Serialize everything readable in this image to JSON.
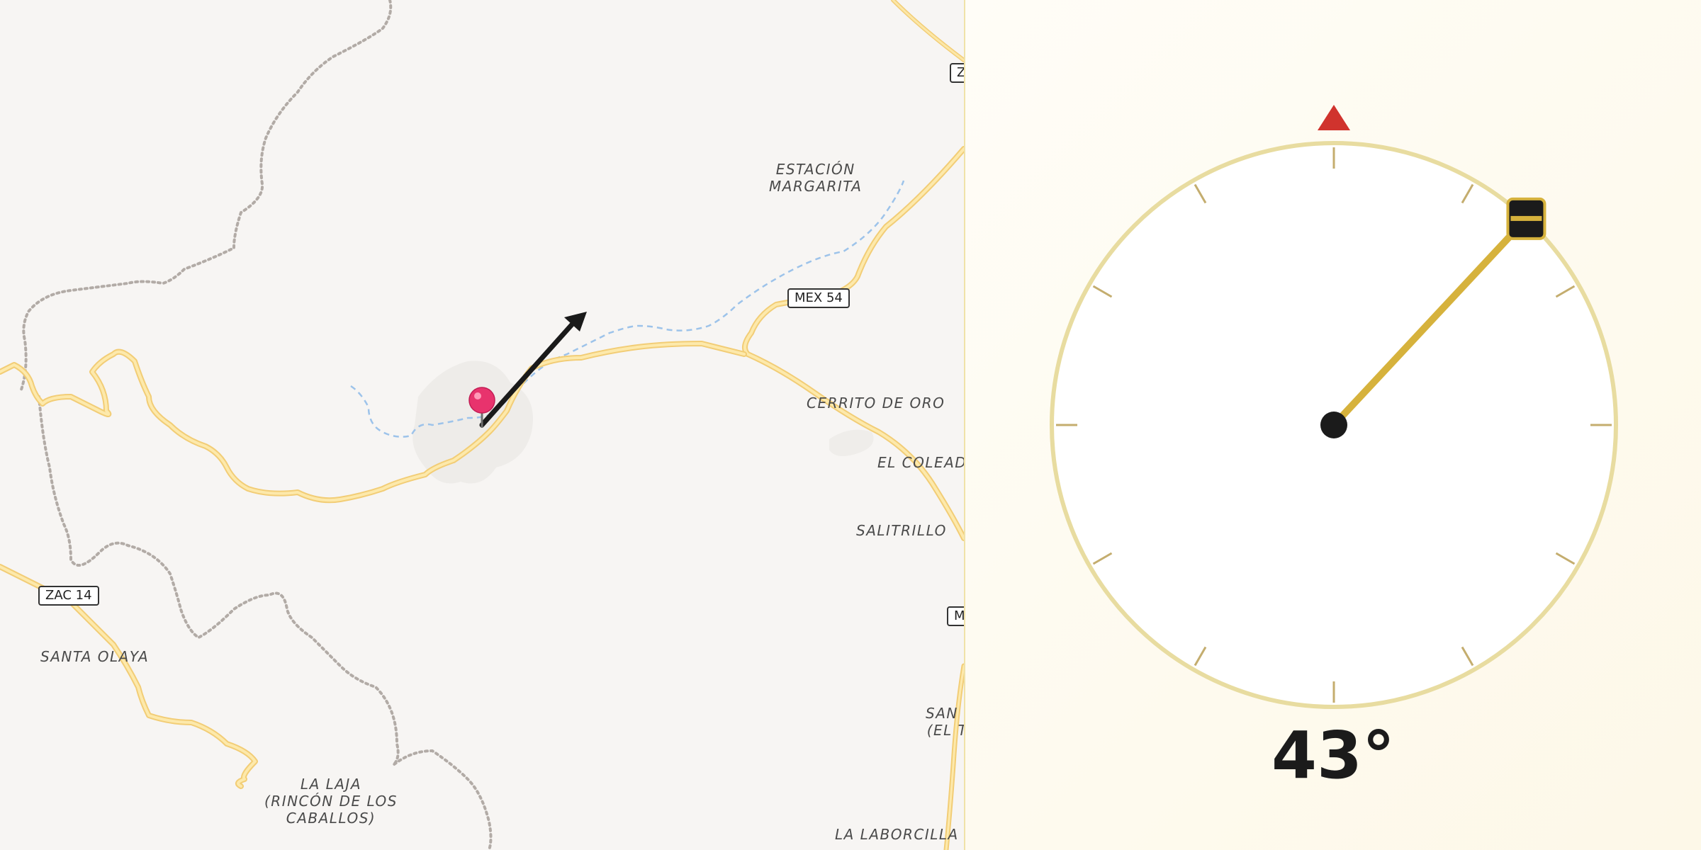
{
  "map": {
    "places": [
      {
        "id": "estacion-margarita",
        "label": "ESTACIÓN\nMARGARITA"
      },
      {
        "id": "cerrito-de-oro",
        "label": "CERRITO DE ORO"
      },
      {
        "id": "el-coleadero",
        "label": "EL COLEADE"
      },
      {
        "id": "salitrillo",
        "label": "SALITRILLO"
      },
      {
        "id": "santa-olaya",
        "label": "SANTA OLAYA"
      },
      {
        "id": "la-laja",
        "label": "LA LAJA\n(RINCÓN DE LOS\nCABALLOS)"
      },
      {
        "id": "san-el",
        "label": "SAN I\n(EL T"
      },
      {
        "id": "la-laborcilla",
        "label": "LA LABORCILLA"
      }
    ],
    "shields": [
      {
        "id": "mex-54",
        "label": "MEX 54"
      },
      {
        "id": "zac-14",
        "label": "ZAC 14"
      },
      {
        "id": "z-top",
        "label": "Z"
      },
      {
        "id": "m-right",
        "label": "M"
      }
    ],
    "marker": {
      "icon": "map-pin-icon",
      "color": "#e8336d"
    },
    "direction_arrow": {
      "icon": "direction-arrow-icon",
      "color": "#1a1a1a"
    }
  },
  "compass": {
    "heading_deg": 43,
    "heading_label": "43°",
    "north_marker_icon": "north-triangle-icon",
    "north_color": "#d0332d",
    "ring_color": "#e8dca0",
    "needle_color": "#d6b23c",
    "handle_icon": "drag-handle-icon"
  }
}
